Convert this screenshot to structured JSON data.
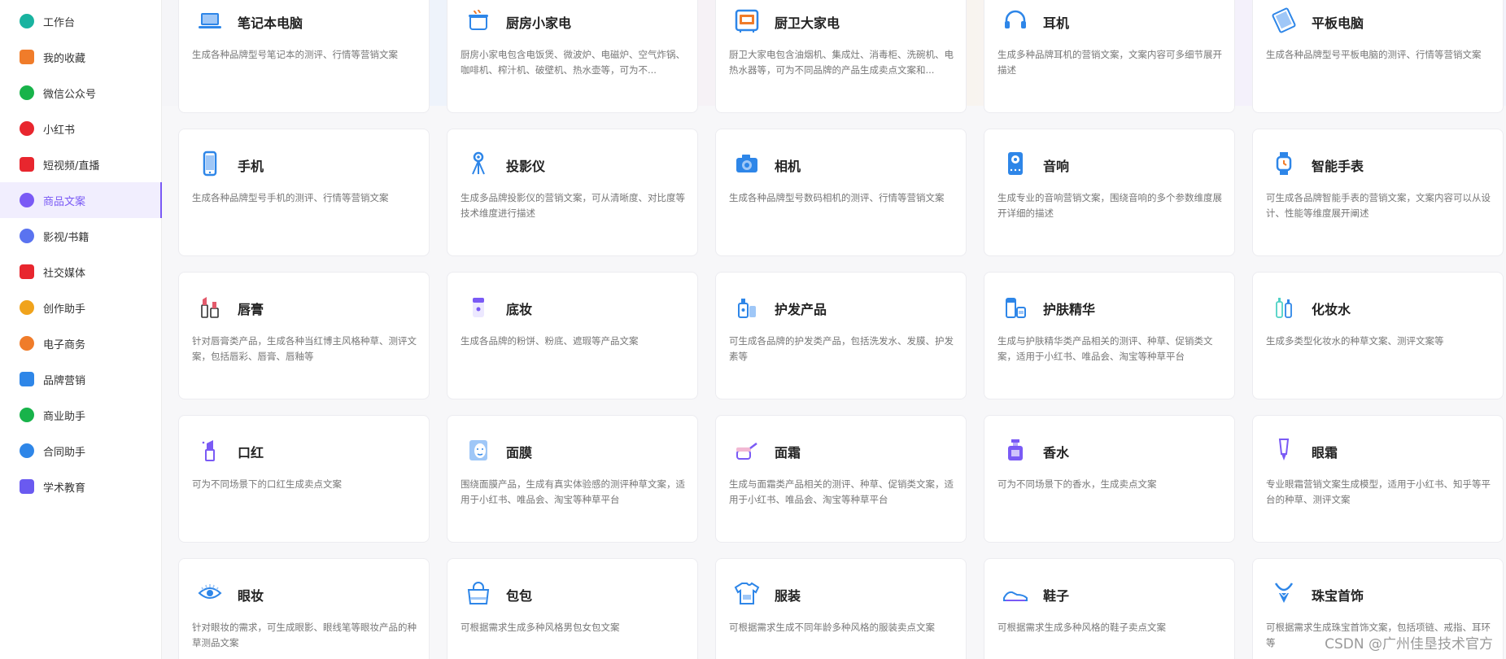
{
  "sidebar": {
    "items": [
      {
        "label": "工作台",
        "icon": "dashboard-icon",
        "color": "#19b3a0"
      },
      {
        "label": "我的收藏",
        "icon": "star-icon",
        "color": "#f07c2a"
      },
      {
        "label": "微信公众号",
        "icon": "wechat-icon",
        "color": "#18b34a"
      },
      {
        "label": "小红书",
        "icon": "xiaohongshu-icon",
        "color": "#e8262e"
      },
      {
        "label": "短视频/直播",
        "icon": "video-icon",
        "color": "#e8262e"
      },
      {
        "label": "商品文案",
        "icon": "product-icon",
        "color": "#7a5af5",
        "active": true
      },
      {
        "label": "影视/书籍",
        "icon": "film-icon",
        "color": "#5a73f0"
      },
      {
        "label": "社交媒体",
        "icon": "cube-icon",
        "color": "#e8262e"
      },
      {
        "label": "创作助手",
        "icon": "writing-icon",
        "color": "#f0a31c"
      },
      {
        "label": "电子商务",
        "icon": "shop-icon",
        "color": "#f07c2a"
      },
      {
        "label": "品牌营销",
        "icon": "users-icon",
        "color": "#2e86e8"
      },
      {
        "label": "商业助手",
        "icon": "bar-chart-icon",
        "color": "#18b34a"
      },
      {
        "label": "合同助手",
        "icon": "contract-icon",
        "color": "#2e86e8"
      },
      {
        "label": "学术教育",
        "icon": "graduation-cap-icon",
        "color": "#6a5af0"
      }
    ]
  },
  "cards": [
    {
      "title": "笔记本电脑",
      "desc": "生成各种品牌型号笔记本的测评、行情等营销文案",
      "icon": "laptop-icon"
    },
    {
      "title": "厨房小家电",
      "desc": "厨房小家电包含电饭煲、微波炉、电磁炉、空气炸锅、咖啡机、榨汁机、破壁机、热水壶等，可为不...",
      "icon": "cooker-icon"
    },
    {
      "title": "厨卫大家电",
      "desc": "厨卫大家电包含油烟机、集成灶、消毒柜、洗碗机、电热水器等，可为不同品牌的产品生成卖点文案和...",
      "icon": "oven-icon"
    },
    {
      "title": "耳机",
      "desc": "生成多种品牌耳机的营销文案，文案内容可多细节展开描述",
      "icon": "headphones-icon"
    },
    {
      "title": "平板电脑",
      "desc": "生成各种品牌型号平板电脑的测评、行情等营销文案",
      "icon": "tablet-icon"
    },
    {
      "title": "手机",
      "desc": "生成各种品牌型号手机的测评、行情等营销文案",
      "icon": "phone-icon"
    },
    {
      "title": "投影仪",
      "desc": "生成多品牌投影仪的营销文案，可从清晰度、对比度等技术维度进行描述",
      "icon": "projector-icon"
    },
    {
      "title": "相机",
      "desc": "生成各种品牌型号数码相机的测评、行情等营销文案",
      "icon": "camera-icon"
    },
    {
      "title": "音响",
      "desc": "生成专业的音响营销文案，围绕音响的多个参数维度展开详细的描述",
      "icon": "speaker-icon"
    },
    {
      "title": "智能手表",
      "desc": "可生成各品牌智能手表的营销文案，文案内容可以从设计、性能等维度展开阐述",
      "icon": "smartwatch-icon"
    },
    {
      "title": "唇膏",
      "desc": "针对唇膏类产品，生成各种当红博主风格种草、测评文案，包括唇彩、唇膏、唇釉等",
      "icon": "lip-balm-icon"
    },
    {
      "title": "底妆",
      "desc": "生成各品牌的粉饼、粉底、遮瑕等产品文案",
      "icon": "foundation-icon"
    },
    {
      "title": "护发产品",
      "desc": "可生成各品牌的护发类产品，包括洗发水、发膜、护发素等",
      "icon": "shampoo-icon"
    },
    {
      "title": "护肤精华",
      "desc": "生成与护肤精华类产品相关的测评、种草、促销类文案，适用于小红书、唯品会、淘宝等种草平台",
      "icon": "serum-icon"
    },
    {
      "title": "化妆水",
      "desc": "生成多类型化妆水的种草文案、测评文案等",
      "icon": "toner-icon"
    },
    {
      "title": "口红",
      "desc": "可为不同场景下的口红生成卖点文案",
      "icon": "lipstick-icon"
    },
    {
      "title": "面膜",
      "desc": "围绕面膜产品，生成有真实体验感的测评种草文案，适用于小红书、唯品会、淘宝等种草平台",
      "icon": "face-mask-icon"
    },
    {
      "title": "面霜",
      "desc": "生成与面霜类产品相关的测评、种草、促销类文案，适用于小红书、唯品会、淘宝等种草平台",
      "icon": "face-cream-icon"
    },
    {
      "title": "香水",
      "desc": "可为不同场景下的香水，生成卖点文案",
      "icon": "perfume-icon"
    },
    {
      "title": "眼霜",
      "desc": "专业眼霜营销文案生成模型，适用于小红书、知乎等平台的种草、测评文案",
      "icon": "eye-cream-icon"
    },
    {
      "title": "眼妆",
      "desc": "针对眼妆的需求，可生成眼影、眼线笔等眼妆产品的种草测品文案",
      "icon": "eye-makeup-icon"
    },
    {
      "title": "包包",
      "desc": "可根据需求生成多种风格男包女包文案",
      "icon": "bag-icon"
    },
    {
      "title": "服装",
      "desc": "可根据需求生成不同年龄多种风格的服装卖点文案",
      "icon": "clothing-icon"
    },
    {
      "title": "鞋子",
      "desc": "可根据需求生成多种风格的鞋子卖点文案",
      "icon": "shoe-icon"
    },
    {
      "title": "珠宝首饰",
      "desc": "可根据需求生成珠宝首饰文案，包括项链、戒指、耳环等",
      "icon": "jewelry-icon"
    }
  ],
  "watermark": "CSDN @广州佳垦技术官方",
  "colors": {
    "accent": "#7a5af5",
    "icon_blue": "#2e86e8",
    "icon_purple": "#7a5af5",
    "icon_orange": "#f07c2a"
  }
}
